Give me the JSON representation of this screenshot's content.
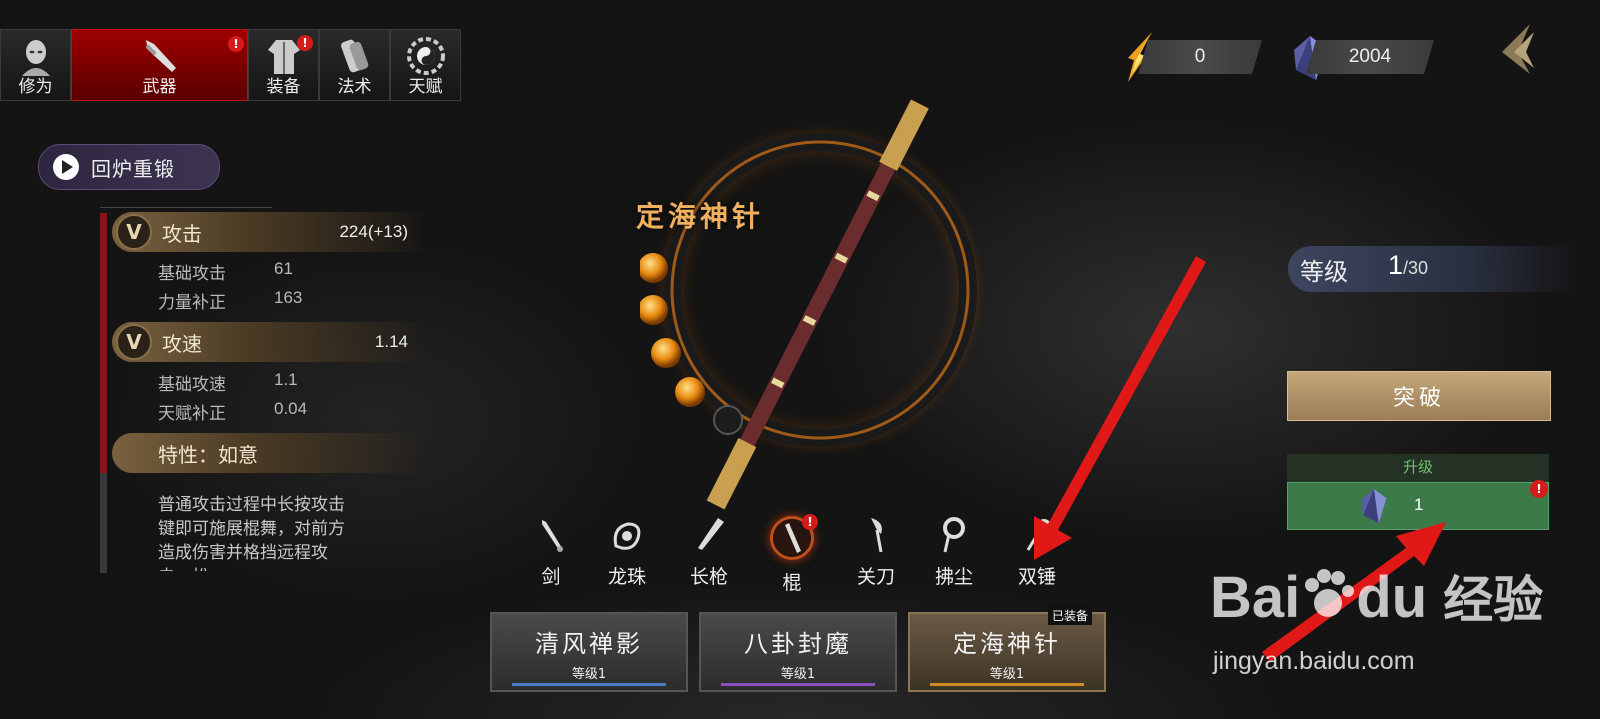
{
  "tabs": [
    {
      "label": "修为",
      "icon": "monk-head-icon",
      "badge": ""
    },
    {
      "label": "武器",
      "icon": "sword-icon",
      "badge": "!"
    },
    {
      "label": "装备",
      "icon": "robe-icon",
      "badge": "!"
    },
    {
      "label": "法术",
      "icon": "scroll-icon",
      "badge": ""
    },
    {
      "label": "天赋",
      "icon": "bagua-icon",
      "badge": ""
    }
  ],
  "currency": {
    "fire": "0",
    "crystal": "2004"
  },
  "reforge_label": "回炉重锻",
  "stats": {
    "attack": {
      "label": "攻击",
      "value": "224(+13)",
      "rows": [
        {
          "k": "基础攻击",
          "v": "61"
        },
        {
          "k": "力量补正",
          "v": "163"
        }
      ]
    },
    "speed": {
      "label": "攻速",
      "value": "1.14",
      "rows": [
        {
          "k": "基础攻速",
          "v": "1.1"
        },
        {
          "k": "天赋补正",
          "v": "0.04"
        }
      ]
    },
    "trait": {
      "label": "特性：如意",
      "desc": "普通攻击过程中长按攻击键即可施展棍舞，对前方造成伤害并格挡远程攻击，松"
    }
  },
  "weapon_name": "定海神针",
  "level": {
    "label": "等级",
    "current": "1",
    "max": "/30"
  },
  "break_label": "突破",
  "upgrade": {
    "title": "升级",
    "cost": "1",
    "badge": "!"
  },
  "weapon_types": [
    "剑",
    "龙珠",
    "长枪",
    "棍",
    "关刀",
    "拂尘",
    "双锤"
  ],
  "selected_type": "棍",
  "cards": [
    {
      "name": "清风禅影",
      "level": "等级1",
      "color": "#4a7ac0"
    },
    {
      "name": "八卦封魔",
      "level": "等级1",
      "color": "#8a50c0"
    },
    {
      "name": "定海神针",
      "level": "等级1",
      "color": "#d08a20"
    }
  ],
  "equipped_label": "已装备",
  "watermark": {
    "brand": "Bai",
    "brand2": "du",
    "cn": "经验",
    "url": "jingyan.baidu.com"
  },
  "colors": {
    "accent_red": "#d61b1b",
    "gold": "#f0b060",
    "green": "#3c7a4a"
  }
}
